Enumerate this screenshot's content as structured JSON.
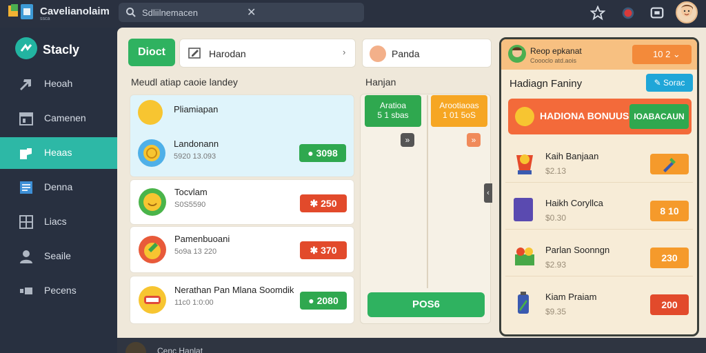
{
  "app": {
    "title": "Cavelianolaim",
    "subtitle": "ssca"
  },
  "search": {
    "text": "Sdliilnemacen"
  },
  "sidebar": {
    "brand": "Stacly",
    "items": [
      {
        "label": "Heoah",
        "icon": "arrow-icon"
      },
      {
        "label": "Camenen",
        "icon": "calendar-icon"
      },
      {
        "label": "Heaas",
        "icon": "tag-icon",
        "active": true
      },
      {
        "label": "Denna",
        "icon": "document-icon"
      },
      {
        "label": "Liacs",
        "icon": "grid-icon"
      },
      {
        "label": "Seaile",
        "icon": "user-icon"
      },
      {
        "label": "Pecens",
        "icon": "dots-icon"
      }
    ]
  },
  "main": {
    "direct_button": "Dioct",
    "selector_one": "Harodan",
    "selector_two": "Panda",
    "list_label": "Meudl atiap caoie landey",
    "items": [
      {
        "title": "Pliamiapan",
        "sub": ""
      },
      {
        "title": "Landonann",
        "sub": "5920 13.093",
        "badge": "3098",
        "badge_color": "green"
      },
      {
        "title": "Tocvlam",
        "sub": "S0S5590",
        "badge": "250",
        "badge_color": "red"
      },
      {
        "title": "Pamenbuoani",
        "sub": "5o9a 13 220",
        "badge": "370",
        "badge_color": "red"
      },
      {
        "title": "Nerathan Pan Mlana Soomdik",
        "sub": "11c0 1:0:00",
        "badge": "2080",
        "badge_color": "green"
      }
    ],
    "mid_label": "Hanjan",
    "mid_col_one": {
      "line1": "Aratioa",
      "line2": "5 1 sbas"
    },
    "mid_col_two": {
      "line1": "Arootiaoas",
      "line2": "1 01 5oS"
    },
    "post_button": "POS6"
  },
  "right": {
    "header_title": "Reop epkanat",
    "header_sub": "Coooclo atd.aois",
    "header_value": "10 2",
    "section_title": "Hadiagn Faniny",
    "save_button": "Sorac",
    "bonus_text": "HADIONA BONUUS",
    "bonus_button": "IOABACAUN",
    "items": [
      {
        "title": "Kaih Banjaan",
        "sub": "$2.13",
        "badge": "icon"
      },
      {
        "title": "Haikh Coryllca",
        "sub": "$0.30",
        "badge": "8 10"
      },
      {
        "title": "Parlan Soonngn",
        "sub": "$2.93",
        "badge": "230"
      },
      {
        "title": "Kiam Praiam",
        "sub": "$9.35",
        "badge": "200"
      }
    ]
  },
  "footer": {
    "label": "Cenc Hanlat"
  }
}
